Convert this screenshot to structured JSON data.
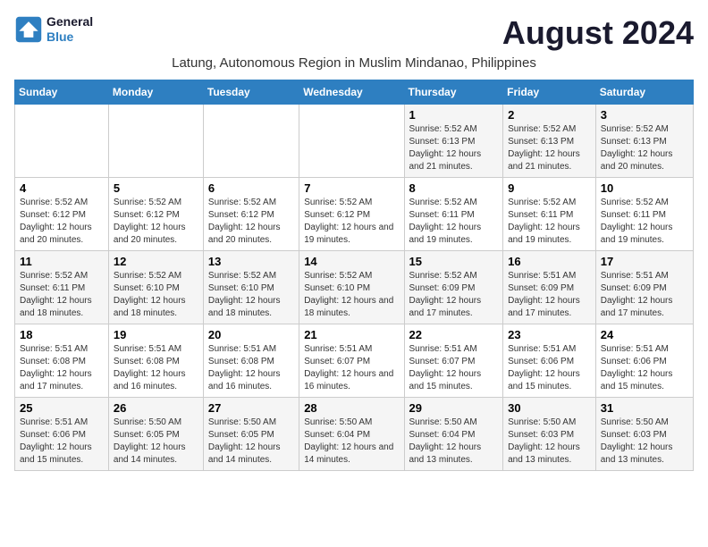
{
  "header": {
    "logo_line1": "General",
    "logo_line2": "Blue",
    "title": "August 2024",
    "subtitle": "Latung, Autonomous Region in Muslim Mindanao, Philippines"
  },
  "days_of_week": [
    "Sunday",
    "Monday",
    "Tuesday",
    "Wednesday",
    "Thursday",
    "Friday",
    "Saturday"
  ],
  "weeks": [
    [
      {
        "day": "",
        "info": ""
      },
      {
        "day": "",
        "info": ""
      },
      {
        "day": "",
        "info": ""
      },
      {
        "day": "",
        "info": ""
      },
      {
        "day": "1",
        "info": "Sunrise: 5:52 AM\nSunset: 6:13 PM\nDaylight: 12 hours and 21 minutes."
      },
      {
        "day": "2",
        "info": "Sunrise: 5:52 AM\nSunset: 6:13 PM\nDaylight: 12 hours and 21 minutes."
      },
      {
        "day": "3",
        "info": "Sunrise: 5:52 AM\nSunset: 6:13 PM\nDaylight: 12 hours and 20 minutes."
      }
    ],
    [
      {
        "day": "4",
        "info": "Sunrise: 5:52 AM\nSunset: 6:12 PM\nDaylight: 12 hours and 20 minutes."
      },
      {
        "day": "5",
        "info": "Sunrise: 5:52 AM\nSunset: 6:12 PM\nDaylight: 12 hours and 20 minutes."
      },
      {
        "day": "6",
        "info": "Sunrise: 5:52 AM\nSunset: 6:12 PM\nDaylight: 12 hours and 20 minutes."
      },
      {
        "day": "7",
        "info": "Sunrise: 5:52 AM\nSunset: 6:12 PM\nDaylight: 12 hours and 19 minutes."
      },
      {
        "day": "8",
        "info": "Sunrise: 5:52 AM\nSunset: 6:11 PM\nDaylight: 12 hours and 19 minutes."
      },
      {
        "day": "9",
        "info": "Sunrise: 5:52 AM\nSunset: 6:11 PM\nDaylight: 12 hours and 19 minutes."
      },
      {
        "day": "10",
        "info": "Sunrise: 5:52 AM\nSunset: 6:11 PM\nDaylight: 12 hours and 19 minutes."
      }
    ],
    [
      {
        "day": "11",
        "info": "Sunrise: 5:52 AM\nSunset: 6:11 PM\nDaylight: 12 hours and 18 minutes."
      },
      {
        "day": "12",
        "info": "Sunrise: 5:52 AM\nSunset: 6:10 PM\nDaylight: 12 hours and 18 minutes."
      },
      {
        "day": "13",
        "info": "Sunrise: 5:52 AM\nSunset: 6:10 PM\nDaylight: 12 hours and 18 minutes."
      },
      {
        "day": "14",
        "info": "Sunrise: 5:52 AM\nSunset: 6:10 PM\nDaylight: 12 hours and 18 minutes."
      },
      {
        "day": "15",
        "info": "Sunrise: 5:52 AM\nSunset: 6:09 PM\nDaylight: 12 hours and 17 minutes."
      },
      {
        "day": "16",
        "info": "Sunrise: 5:51 AM\nSunset: 6:09 PM\nDaylight: 12 hours and 17 minutes."
      },
      {
        "day": "17",
        "info": "Sunrise: 5:51 AM\nSunset: 6:09 PM\nDaylight: 12 hours and 17 minutes."
      }
    ],
    [
      {
        "day": "18",
        "info": "Sunrise: 5:51 AM\nSunset: 6:08 PM\nDaylight: 12 hours and 17 minutes."
      },
      {
        "day": "19",
        "info": "Sunrise: 5:51 AM\nSunset: 6:08 PM\nDaylight: 12 hours and 16 minutes."
      },
      {
        "day": "20",
        "info": "Sunrise: 5:51 AM\nSunset: 6:08 PM\nDaylight: 12 hours and 16 minutes."
      },
      {
        "day": "21",
        "info": "Sunrise: 5:51 AM\nSunset: 6:07 PM\nDaylight: 12 hours and 16 minutes."
      },
      {
        "day": "22",
        "info": "Sunrise: 5:51 AM\nSunset: 6:07 PM\nDaylight: 12 hours and 15 minutes."
      },
      {
        "day": "23",
        "info": "Sunrise: 5:51 AM\nSunset: 6:06 PM\nDaylight: 12 hours and 15 minutes."
      },
      {
        "day": "24",
        "info": "Sunrise: 5:51 AM\nSunset: 6:06 PM\nDaylight: 12 hours and 15 minutes."
      }
    ],
    [
      {
        "day": "25",
        "info": "Sunrise: 5:51 AM\nSunset: 6:06 PM\nDaylight: 12 hours and 15 minutes."
      },
      {
        "day": "26",
        "info": "Sunrise: 5:50 AM\nSunset: 6:05 PM\nDaylight: 12 hours and 14 minutes."
      },
      {
        "day": "27",
        "info": "Sunrise: 5:50 AM\nSunset: 6:05 PM\nDaylight: 12 hours and 14 minutes."
      },
      {
        "day": "28",
        "info": "Sunrise: 5:50 AM\nSunset: 6:04 PM\nDaylight: 12 hours and 14 minutes."
      },
      {
        "day": "29",
        "info": "Sunrise: 5:50 AM\nSunset: 6:04 PM\nDaylight: 12 hours and 13 minutes."
      },
      {
        "day": "30",
        "info": "Sunrise: 5:50 AM\nSunset: 6:03 PM\nDaylight: 12 hours and 13 minutes."
      },
      {
        "day": "31",
        "info": "Sunrise: 5:50 AM\nSunset: 6:03 PM\nDaylight: 12 hours and 13 minutes."
      }
    ]
  ]
}
